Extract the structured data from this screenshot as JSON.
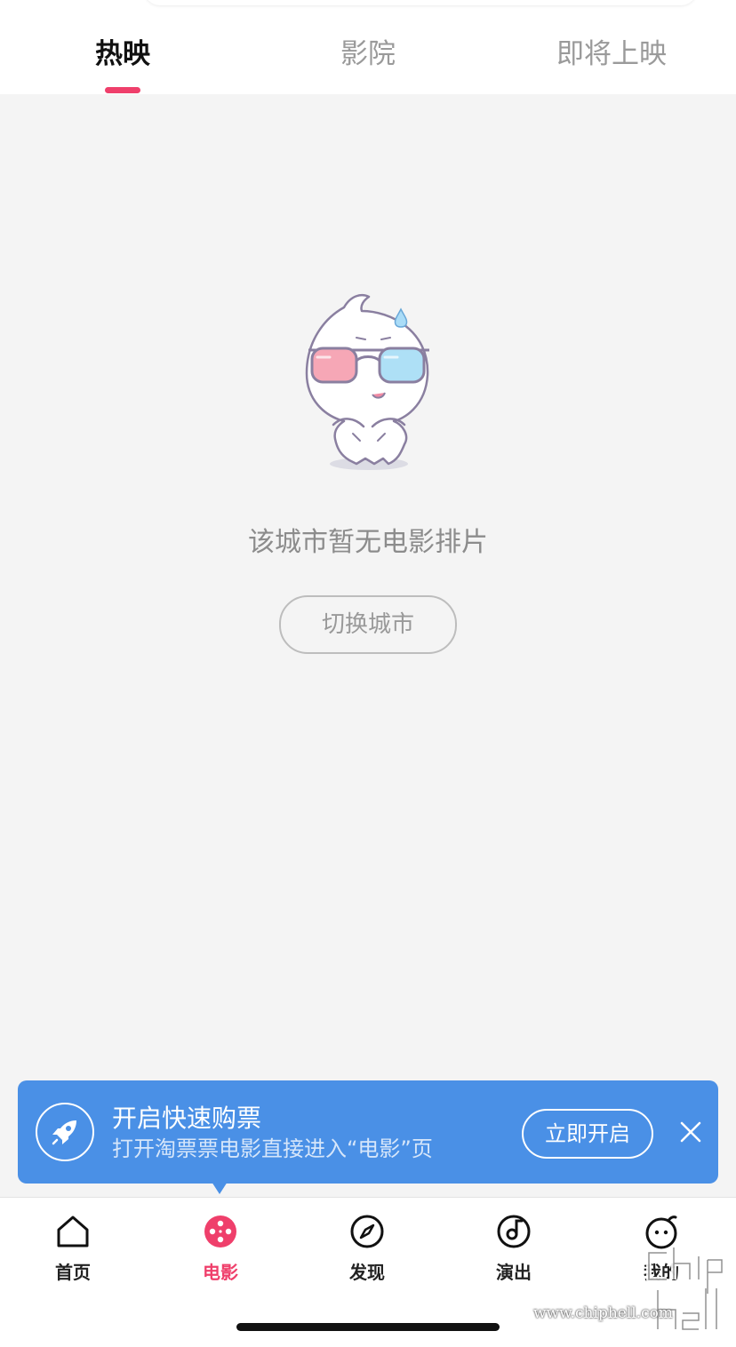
{
  "tabs": [
    {
      "label": "热映",
      "active": true
    },
    {
      "label": "影院",
      "active": false
    },
    {
      "label": "即将上映",
      "active": false
    }
  ],
  "accent_color": "#ef3f6b",
  "empty_state": {
    "mascot_icon": "3d-glasses-mascot",
    "message": "该城市暂无电影排片",
    "switch_city_label": "切换城市"
  },
  "banner": {
    "icon": "rocket-icon",
    "title": "开启快速购票",
    "subtitle": "打开淘票票电影直接进入“电影”页",
    "open_label": "立即开启",
    "close_icon": "close-icon",
    "color": "#4a90e6"
  },
  "tabbar": {
    "items": [
      {
        "label": "首页",
        "icon": "home-icon",
        "active": false
      },
      {
        "label": "电影",
        "icon": "movie-icon",
        "active": true
      },
      {
        "label": "发现",
        "icon": "compass-icon",
        "active": false
      },
      {
        "label": "演出",
        "icon": "music-note-icon",
        "active": false
      },
      {
        "label": "我的",
        "icon": "smiley-icon",
        "active": false
      }
    ]
  },
  "watermark": {
    "text": "www.chiphell.com",
    "logo_text": "chip hell"
  }
}
